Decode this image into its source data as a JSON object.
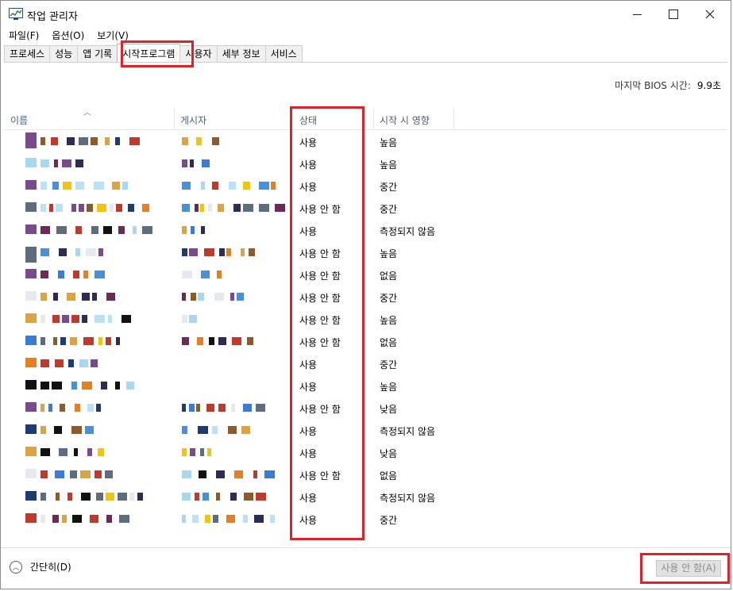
{
  "window": {
    "title": "작업 관리자",
    "controls": {
      "minimize": "—",
      "maximize": "□",
      "close": "✕"
    }
  },
  "menu": [
    "파일(F)",
    "옵션(O)",
    "보기(V)"
  ],
  "tabs": [
    "프로세스",
    "성능",
    "앱 기록",
    "시작프로그램",
    "사용자",
    "세부 정보",
    "서비스"
  ],
  "active_tab": "시작프로그램",
  "bios": {
    "label": "마지막 BIOS 시간:",
    "value": "9.9초"
  },
  "columns": [
    "이름",
    "게시자",
    "상태",
    "시작 시 영향"
  ],
  "rows": [
    {
      "status": "사용",
      "impact": "높음"
    },
    {
      "status": "사용",
      "impact": "높음"
    },
    {
      "status": "사용",
      "impact": "중간"
    },
    {
      "status": "사용 안 함",
      "impact": "중간"
    },
    {
      "status": "사용",
      "impact": "측정되지 않음"
    },
    {
      "status": "사용 안 함",
      "impact": "높음"
    },
    {
      "status": "사용 안 함",
      "impact": "없음"
    },
    {
      "status": "사용 안 함",
      "impact": "중간"
    },
    {
      "status": "사용 안 함",
      "impact": "높음"
    },
    {
      "status": "사용 안 함",
      "impact": "없음"
    },
    {
      "status": "사용",
      "impact": "중간"
    },
    {
      "status": "사용",
      "impact": "높음"
    },
    {
      "status": "사용 안 함",
      "impact": "낮음"
    },
    {
      "status": "사용",
      "impact": "측정되지 않음"
    },
    {
      "status": "사용",
      "impact": "낮음"
    },
    {
      "status": "사용 안 함",
      "impact": "없음"
    },
    {
      "status": "사용",
      "impact": "측정되지 않음"
    },
    {
      "status": "사용",
      "impact": "중간"
    }
  ],
  "footer": {
    "collapse_label": "간단히(D)",
    "disable_button": "사용 안 함(A)"
  },
  "colors": {
    "highlight": "#e2202a",
    "header_text": "#4c607a"
  }
}
